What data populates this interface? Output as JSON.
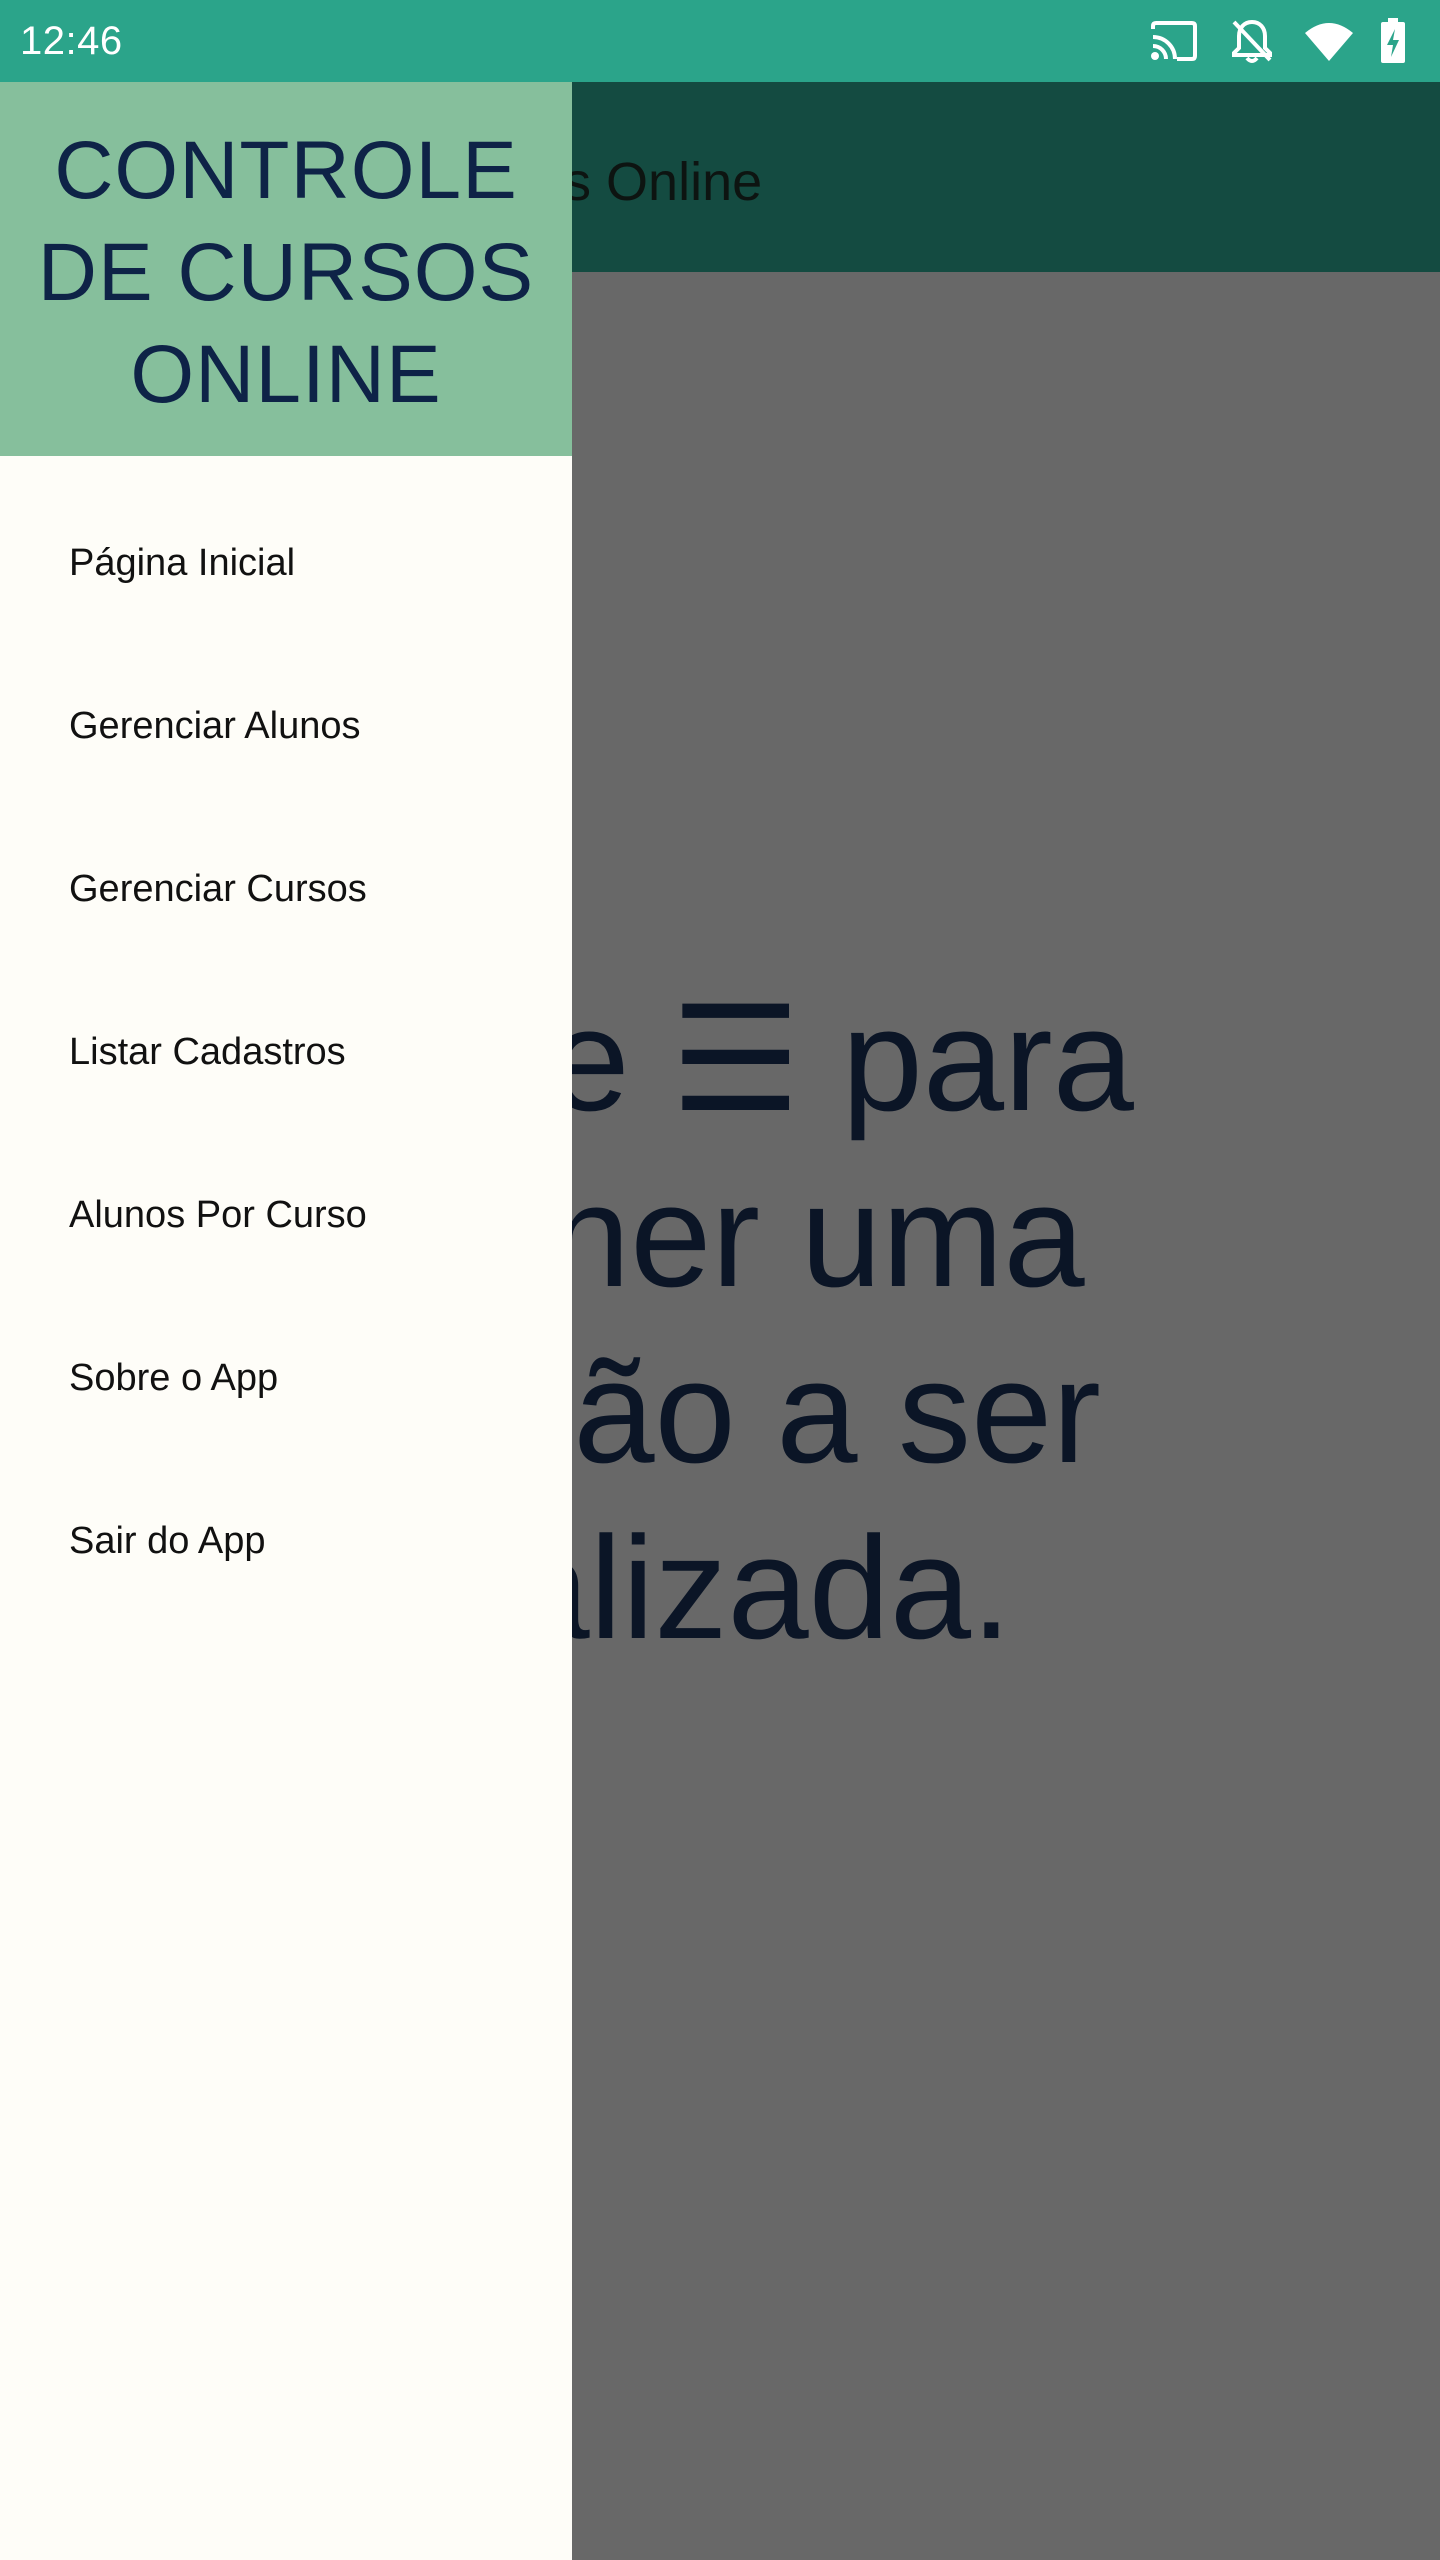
{
  "status_bar": {
    "time": "12:46",
    "icons": [
      "cast-icon",
      "notifications-off-icon",
      "wifi-icon",
      "battery-charging-icon"
    ],
    "background": "#2ba48a"
  },
  "app_bar": {
    "title": "Cursos Online",
    "background": "#144b41"
  },
  "main": {
    "instruction": "one ☰ para\nolher uma\nação a ser\nalizada."
  },
  "drawer": {
    "header_title": "CONTROLE DE CURSOS ONLINE",
    "header_background": "#86bf9c",
    "items": [
      {
        "label": "Página Inicial"
      },
      {
        "label": "Gerenciar Alunos"
      },
      {
        "label": "Gerenciar Cursos"
      },
      {
        "label": "Listar Cadastros"
      },
      {
        "label": "Alunos Por Curso"
      },
      {
        "label": "Sobre o App"
      },
      {
        "label": "Sair do App"
      }
    ]
  },
  "colors": {
    "scrim": "#686868",
    "drawer_background": "#fefdf8",
    "title_text": "#0e2347"
  }
}
